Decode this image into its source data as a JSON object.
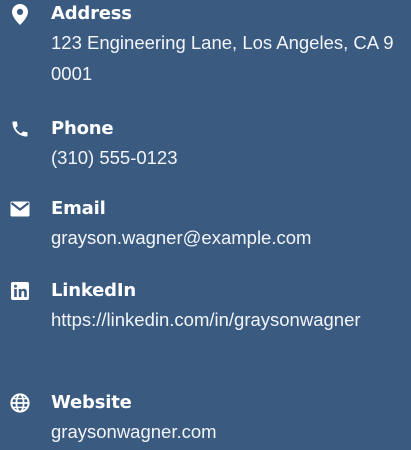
{
  "contact": {
    "address": {
      "icon": "location-pin-icon",
      "label": "Address",
      "value": "123 Engineering Lane, Los Angeles, CA 90001"
    },
    "phone": {
      "icon": "phone-icon",
      "label": "Phone",
      "value": "(310) 555-0123"
    },
    "email": {
      "icon": "envelope-icon",
      "label": "Email",
      "value": "grayson.wagner@example.com"
    },
    "linkedin": {
      "icon": "linkedin-icon",
      "label": "LinkedIn",
      "value": "https://linkedin.com/in/graysonwagner"
    },
    "website": {
      "icon": "globe-icon",
      "label": "Website",
      "value": "graysonwagner.com"
    }
  },
  "colors": {
    "background": "#3a5a80",
    "text": "#ffffff"
  }
}
